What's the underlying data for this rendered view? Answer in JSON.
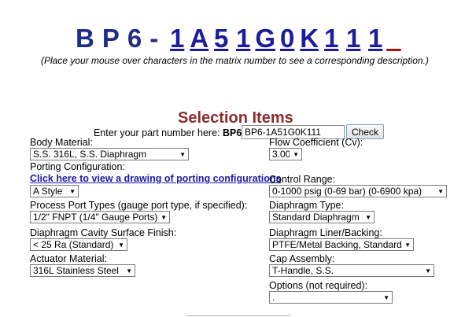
{
  "part_number": {
    "fixed_prefix": "BP6-",
    "chars": [
      "1",
      "A",
      "5",
      "1",
      "G",
      "0",
      "K",
      "1",
      "1",
      "1",
      "_"
    ]
  },
  "hover_note": "(Place your mouse over characters in the matrix number to see a corresponding description.)",
  "section_title": "Selection Items",
  "lookup": {
    "prompt": "Enter your part number here:",
    "prefix": "BP6-",
    "input_value": "BP6-1A51G0K111",
    "button_label": "Check"
  },
  "left": {
    "body_material": {
      "label": "Body Material:",
      "value": "S.S. 316L, S.S. Diaphragm"
    },
    "porting": {
      "label": "Porting Configuration:",
      "link": "Click here to view a drawing of porting configurations",
      "value": "A Style"
    },
    "process_port": {
      "label": "Process Port Types (gauge port type, if specified):",
      "value": "1/2\" FNPT (1/4\" Gauge Ports)"
    },
    "cavity_finish": {
      "label": "Diaphragm Cavity Surface Finish:",
      "value": "< 25 Ra (Standard)"
    },
    "actuator": {
      "label": "Actuator Material:",
      "value": "316L Stainless Steel"
    }
  },
  "right": {
    "flow_coefficient": {
      "label": "Flow Coefficient (Cv):",
      "value": "3.00"
    },
    "control_range": {
      "label": "Control Range:",
      "value": "0-1000 psig (0-69 bar) (0-6900 kpa)"
    },
    "diaphragm_type": {
      "label": "Diaphragm Type:",
      "value": "Standard Diaphragm"
    },
    "liner": {
      "label": "Diaphragm Liner/Backing:",
      "value": "PTFE/Metal Backing, Standard"
    },
    "cap": {
      "label": "Cap Assembly:",
      "value": "T-Handle, S.S."
    },
    "options": {
      "label": "Options (not required):",
      "value": "."
    }
  }
}
